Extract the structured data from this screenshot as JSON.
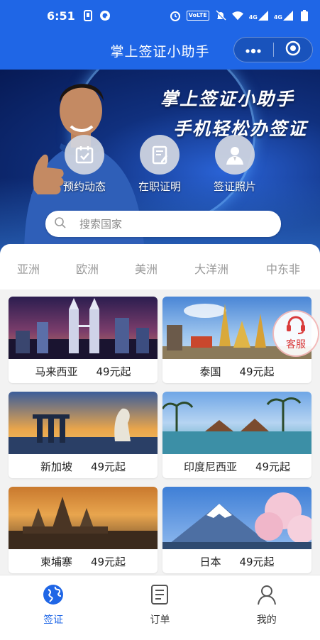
{
  "status_bar": {
    "time": "6:51",
    "volte": "VoLTE",
    "net1": "4G",
    "net2": "4G"
  },
  "nav": {
    "title": "掌上签证小助手",
    "more_icon": "more-dots-icon",
    "close_icon": "target-circle-icon"
  },
  "banner": {
    "slogan_line1": "掌上签证小助手",
    "slogan_line2": "手机轻松办签证",
    "shortcuts": [
      {
        "label": "预约动态",
        "icon": "calendar-check-icon"
      },
      {
        "label": "在职证明",
        "icon": "document-pen-icon"
      },
      {
        "label": "签证照片",
        "icon": "person-photo-icon"
      }
    ],
    "search_placeholder": "搜索国家"
  },
  "regions": [
    "亚洲",
    "欧洲",
    "美洲",
    "大洋洲",
    "中东非"
  ],
  "countries": [
    {
      "name": "马来西亚",
      "price": "49元起"
    },
    {
      "name": "泰国",
      "price": "49元起"
    },
    {
      "name": "新加坡",
      "price": "49元起"
    },
    {
      "name": "印度尼西亚",
      "price": "49元起"
    },
    {
      "name": "柬埔寨",
      "price": "49元起"
    },
    {
      "name": "日本",
      "price": "49元起"
    }
  ],
  "service": {
    "label": "客服"
  },
  "tabbar": [
    {
      "label": "签证",
      "icon": "globe-icon",
      "active": true
    },
    {
      "label": "订单",
      "icon": "document-list-icon",
      "active": false
    },
    {
      "label": "我的",
      "icon": "user-icon",
      "active": false
    }
  ],
  "colors": {
    "brand_blue": "#1f66e6",
    "service_red": "#d93b3b"
  }
}
